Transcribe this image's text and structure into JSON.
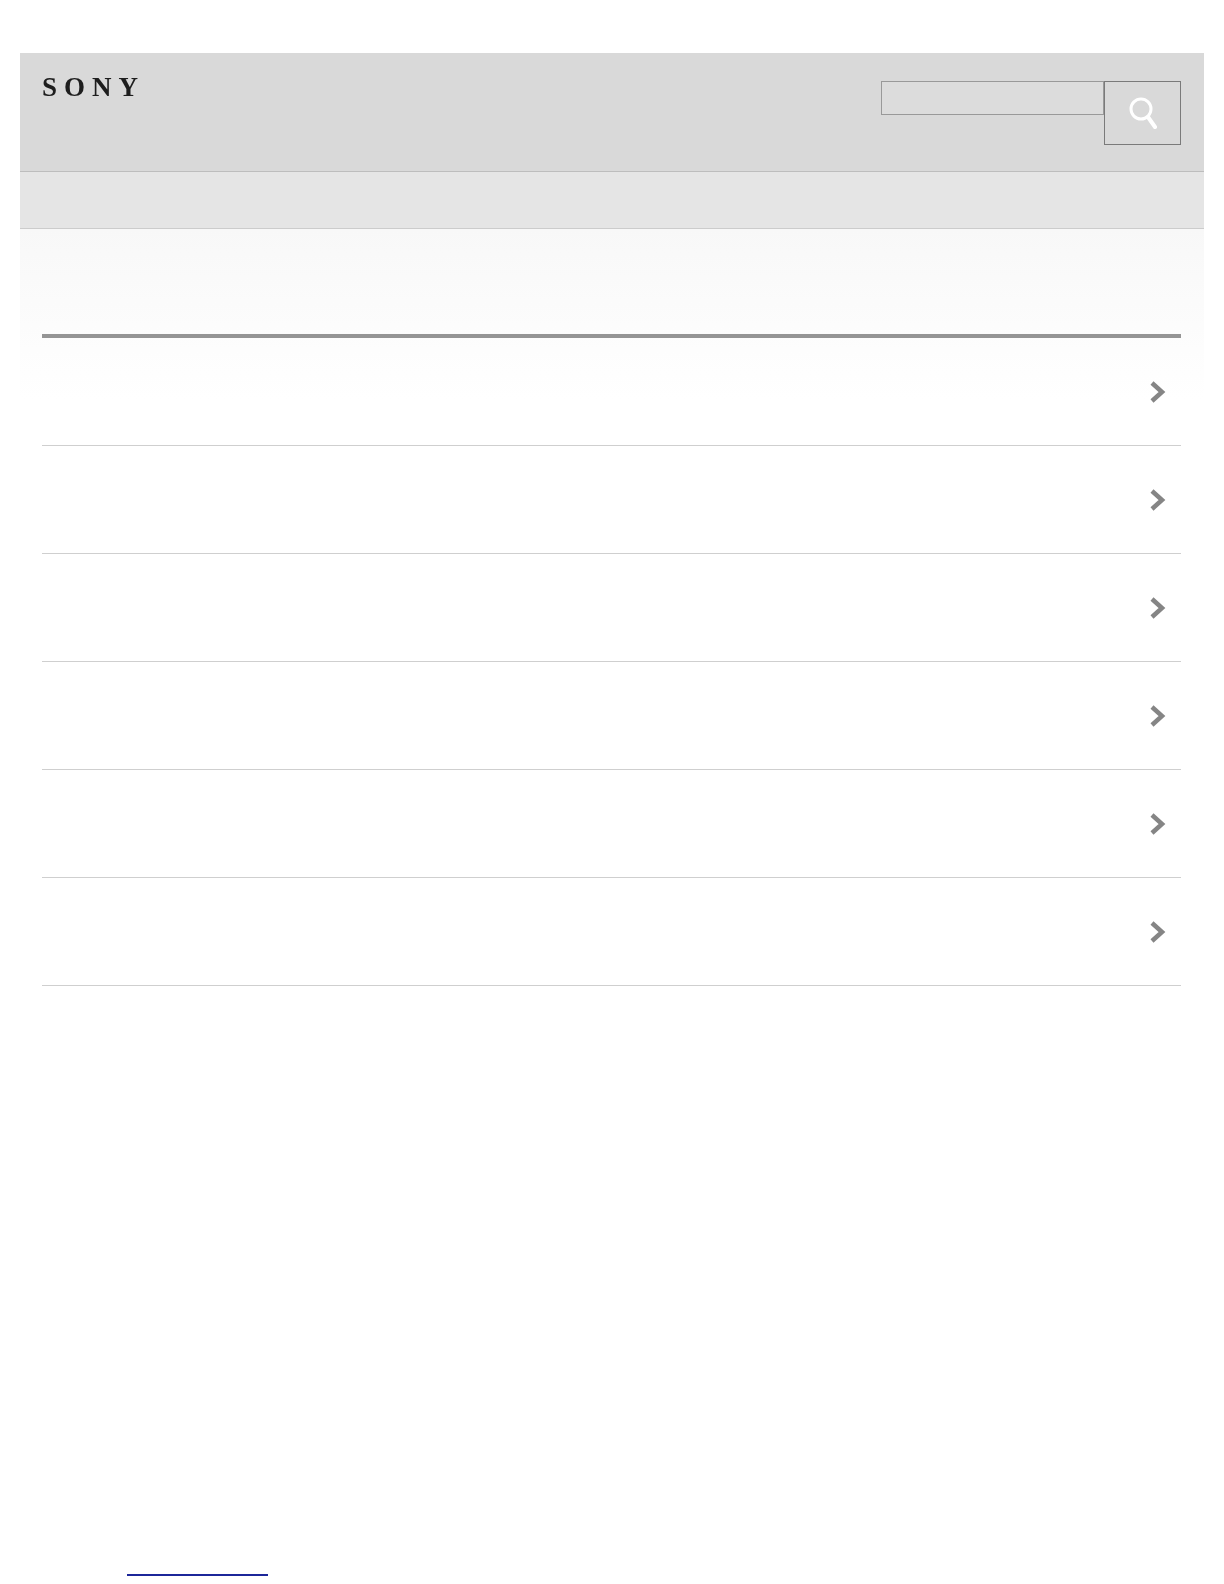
{
  "header": {
    "logo": "SONY"
  },
  "list": {
    "rows": [
      {
        "arrow": true
      },
      {
        "arrow": true
      },
      {
        "arrow": true
      },
      {
        "arrow": true
      },
      {
        "arrow": true
      },
      {
        "arrow": true
      }
    ]
  }
}
